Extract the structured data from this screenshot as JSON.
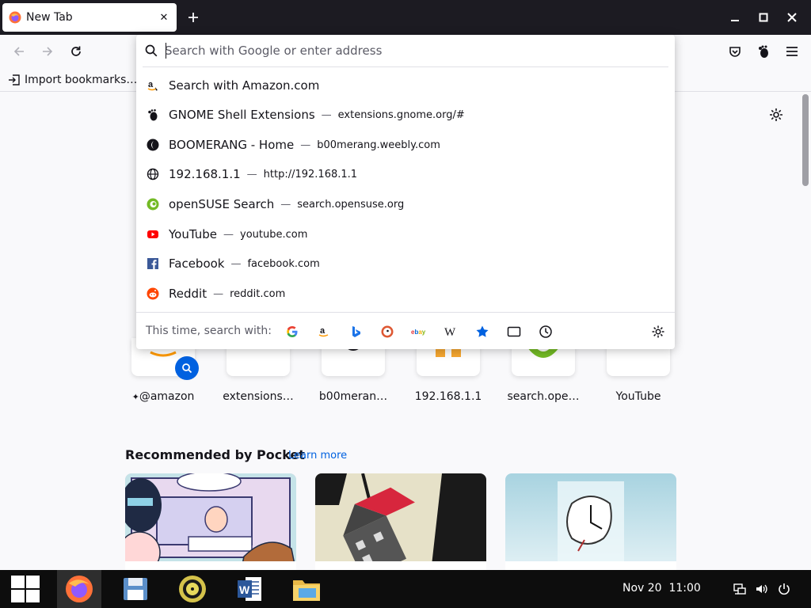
{
  "window": {
    "tab_title": "New Tab",
    "tab_close": "✕",
    "new_tab": "+",
    "minimize_icon": "minimize-icon",
    "maximize_icon": "maximize-icon",
    "close_icon": "close-icon"
  },
  "toolbar": {
    "back": "back-arrow-icon",
    "forward": "forward-arrow-icon",
    "reload": "reload-icon",
    "pocket": "pocket-icon",
    "extensions": "gnome-extensions-icon",
    "menu": "hamburger-menu-icon"
  },
  "bookmarks": {
    "import_label": "Import bookmarks…"
  },
  "urlbar": {
    "placeholder": "Search with Google or enter address",
    "value": "",
    "results": [
      {
        "icon": "amazon-icon",
        "title": "Search with Amazon.com",
        "url": ""
      },
      {
        "icon": "gnome-icon",
        "title": "GNOME Shell Extensions",
        "url": "extensions.gnome.org/#"
      },
      {
        "icon": "boomerang-icon",
        "title": "BOOMERANG - Home",
        "url": "b00merang.weebly.com"
      },
      {
        "icon": "globe-icon",
        "title": "192.168.1.1",
        "url": "http://192.168.1.1"
      },
      {
        "icon": "opensuse-icon",
        "title": "openSUSE Search",
        "url": "search.opensuse.org"
      },
      {
        "icon": "youtube-icon",
        "title": "YouTube",
        "url": "youtube.com"
      },
      {
        "icon": "facebook-icon",
        "title": "Facebook",
        "url": "facebook.com"
      },
      {
        "icon": "reddit-icon",
        "title": "Reddit",
        "url": "reddit.com"
      }
    ],
    "dash": "—",
    "oneoff_label": "This time, search with:",
    "engines": [
      {
        "name": "google-icon",
        "glyph": "G"
      },
      {
        "name": "amazon-engine-icon",
        "glyph": "a"
      },
      {
        "name": "bing-icon",
        "glyph": "b"
      },
      {
        "name": "duckduckgo-icon",
        "glyph": ""
      },
      {
        "name": "ebay-icon",
        "glyph": "ebay"
      },
      {
        "name": "wikipedia-icon",
        "glyph": "W"
      },
      {
        "name": "bookmarks-star-icon",
        "glyph": ""
      },
      {
        "name": "tabs-icon",
        "glyph": ""
      },
      {
        "name": "history-icon",
        "glyph": ""
      }
    ],
    "settings_icon": "search-settings-gear-icon"
  },
  "newtab": {
    "shortcuts": [
      {
        "label": "@amazon",
        "prefix": "✦"
      },
      {
        "label": "extensions…"
      },
      {
        "label": "b00meran…"
      },
      {
        "label": "192.168.1.1"
      },
      {
        "label": "search.ope…"
      },
      {
        "label": "YouTube"
      }
    ],
    "pocket_title": "Recommended by Pocket",
    "pocket_learn_more": "Learn more"
  },
  "taskbar": {
    "apps": [
      "windows-start-icon",
      "firefox-icon",
      "save-disk-icon",
      "music-player-icon",
      "word-icon",
      "file-manager-icon"
    ],
    "clock": "Nov 20  11:00"
  },
  "colors": {
    "accent": "#0061e0",
    "titlebar": "#1c1b22",
    "taskbar": "#0d0d0d"
  }
}
